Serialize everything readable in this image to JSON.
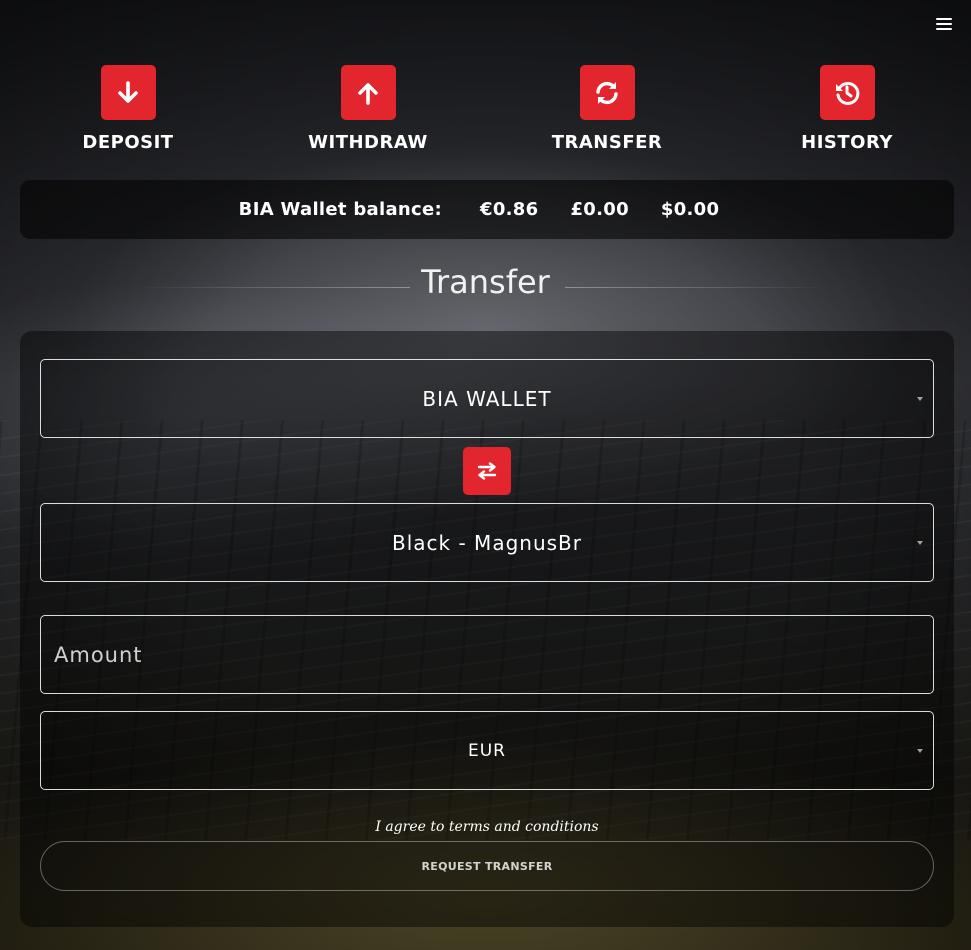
{
  "nav": {
    "menu_icon": "hamburger-menu-icon"
  },
  "actions": {
    "deposit": {
      "label": "DEPOSIT",
      "icon": "arrow-down-icon"
    },
    "withdraw": {
      "label": "WITHDRAW",
      "icon": "arrow-up-icon"
    },
    "transfer": {
      "label": "TRANSFER",
      "icon": "refresh-icon"
    },
    "history": {
      "label": "HISTORY",
      "icon": "history-icon"
    },
    "accent_color": "#e3252d"
  },
  "balance": {
    "label": "BIA Wallet balance:",
    "eur": "€0.86",
    "gbp": "£0.00",
    "usd": "$0.00"
  },
  "transfer": {
    "title": "Transfer",
    "from_account": "BIA WALLET",
    "to_account": "Black - MagnusBr",
    "swap_icon": "swap-arrows-icon",
    "amount_placeholder": "Amount",
    "currency": "EUR",
    "terms_text": "I agree to terms and conditions",
    "submit_label": "REQUEST TRANSFER"
  }
}
